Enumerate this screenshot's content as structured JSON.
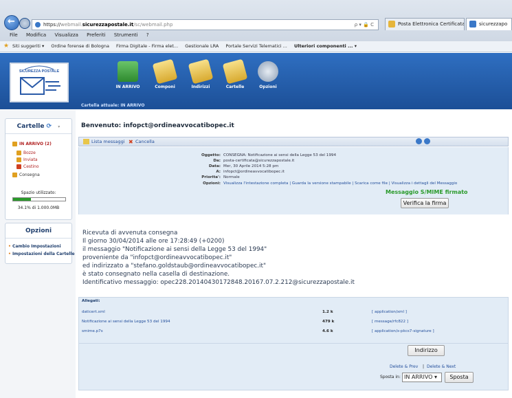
{
  "browser": {
    "url_prefix": "https://",
    "url_host_dim": "webmail.",
    "url_host": "sicurezzapostale.it",
    "url_path": "/sc/webmail.php",
    "addr_controls": "ρ ▾ 🔒 C",
    "tabs": [
      {
        "label": "Posta Elettronica Certificata"
      },
      {
        "label": "sicurezzapo"
      }
    ],
    "menu": [
      "File",
      "Modifica",
      "Visualizza",
      "Preferiti",
      "Strumenti",
      "?"
    ],
    "favorites": [
      "Siti suggeriti ▾",
      "Ordine forense di Bologna",
      "Firma Digitale - Firma elet...",
      "Gestionale LRA",
      "Portale Servizi Telematici ...",
      "Ulteriori componenti ... ▾"
    ]
  },
  "app": {
    "logo_text": "SICUREZZA POSTALE",
    "toolbar": [
      {
        "label": "IN ARRIVO",
        "icon": "inbox-icon",
        "color": "#3d9b3d"
      },
      {
        "label": "Componi",
        "icon": "compose-icon",
        "color": "#e8c64a"
      },
      {
        "label": "Indirizzi",
        "icon": "addressbook-icon",
        "color": "#e8c64a"
      },
      {
        "label": "Cartelle",
        "icon": "folders-icon",
        "color": "#e8c64a"
      },
      {
        "label": "Opzioni",
        "icon": "options-icon",
        "color": "#9fb0c4"
      }
    ],
    "current_folder": "Cartella attuale: IN ARRIVO"
  },
  "sidebar": {
    "folders_title": "Cartelle",
    "folders": [
      {
        "label": "IN ARRIVO (2)",
        "color": "#e0a020"
      },
      {
        "label": "Bozze",
        "color": "#e0a020"
      },
      {
        "label": "Inviata",
        "color": "#e0a020"
      },
      {
        "label": "Cestino",
        "color": "#d04020"
      },
      {
        "label": "Consegna",
        "color": "#e0a020"
      }
    ],
    "space_label": "Spazio utilizzato:",
    "space_value": "34.1% di 1.000.0MB",
    "space_fraction": 0.341,
    "options_title": "Opzioni",
    "options": [
      "Cambio Impostazioni",
      "Impostazioni della Cartelle"
    ]
  },
  "main": {
    "welcome": "Benvenuto: infopct@ordineavvocatibopec.it",
    "list_link": "Lista messaggi",
    "delete_link": "Cancella",
    "headers": [
      {
        "key": "Oggetto:",
        "value": "CONSEGNA: Notificazione ai sensi della Legge 53 del 1994"
      },
      {
        "key": "Da:",
        "value": "posta-certificata@sicurezzapostale.it"
      },
      {
        "key": "Data:",
        "value": "Mer, 30 Aprile 2014 5:28 pm"
      },
      {
        "key": "A:",
        "value": "infopct@ordineavvocatibopec.it"
      },
      {
        "key": "Priorita':",
        "value": "Normale"
      },
      {
        "key": "Opzioni:",
        "value": "Visualizza l'intestazione completa  |  Guarda la versione stampabile  |  Scarica come file  |  Visualizza i dettagli del Messaggio"
      }
    ],
    "smime_label": "Messaggio S/MIME firmato",
    "verify_button": "Verifica la firma",
    "body_lines": [
      "Ricevuta di avvenuta consegna",
      "Il giorno 30/04/2014 alle ore 17:28:49 (+0200)",
      "il messaggio \"Notificazione ai sensi della Legge 53 del 1994\"",
      "proveniente da \"infopct@ordineavvocatibopec.it\"",
      "ed indirizzato a \"stefano.goldstaub@ordineavvocatibopec.it\"",
      "è stato consegnato nella casella di destinazione.",
      "Identificativo messaggio: opec228.20140430172848.20167.07.2.212@sicurezzapostale.it"
    ],
    "attachments_title": "Allegati:",
    "attachments": [
      {
        "name": "daticert.xml",
        "size": "1.2 k",
        "type": "[ application/xml ]"
      },
      {
        "name": "Notificazione ai sensi della Legge 53 del 1994",
        "size": "479 k",
        "type": "[ message/rfc822 ]"
      },
      {
        "name": "smime.p7s",
        "size": "4.6 k",
        "type": "[ application/x-pkcs7-signature ]"
      }
    ],
    "address_button": "Indirizzo",
    "delete_prev": "Delete & Prev",
    "delete_next": "Delete & Next",
    "move_label": "Sposta in:",
    "move_select": "IN ARRIVO ▾",
    "move_button": "Sposta"
  }
}
